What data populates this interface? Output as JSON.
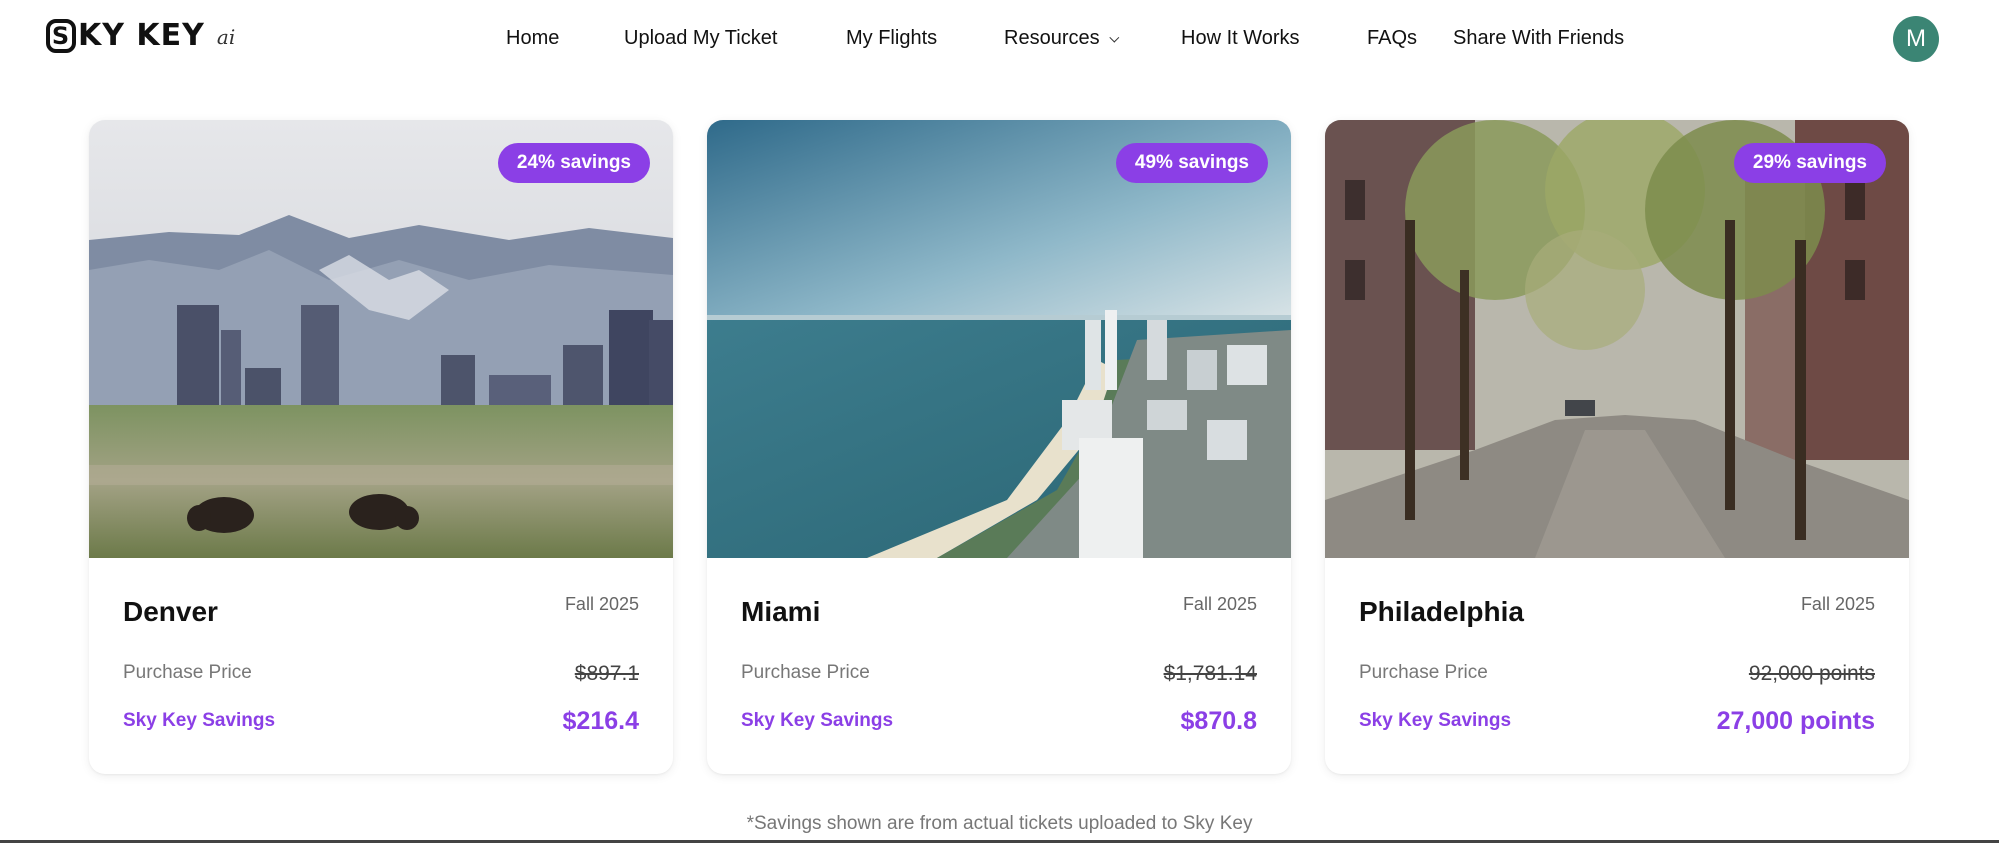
{
  "brand": {
    "logo_text": "KY KEY",
    "logo_s": "S",
    "logo_suffix": "ai"
  },
  "nav": {
    "items": [
      {
        "label": "Home"
      },
      {
        "label": "Upload My Ticket"
      },
      {
        "label": "My Flights"
      },
      {
        "label": "Resources"
      },
      {
        "label": "How It Works"
      },
      {
        "label": "FAQs"
      },
      {
        "label": "Share With Friends"
      }
    ],
    "avatar_initial": "M"
  },
  "cards": [
    {
      "city": "Denver",
      "season": "Fall 2025",
      "badge": "24% savings",
      "purchase_label": "Purchase Price",
      "purchase_price": "$897.1",
      "savings_label": "Sky Key Savings",
      "savings_value": "$216.4"
    },
    {
      "city": "Miami",
      "season": "Fall 2025",
      "badge": "49% savings",
      "purchase_label": "Purchase Price",
      "purchase_price": "$1,781.14",
      "savings_label": "Sky Key Savings",
      "savings_value": "$870.8"
    },
    {
      "city": "Philadelphia",
      "season": "Fall 2025",
      "badge": "29% savings",
      "purchase_label": "Purchase Price",
      "purchase_price": "92,000 points",
      "savings_label": "Sky Key Savings",
      "savings_value": "27,000 points"
    }
  ],
  "footnote": "*Savings shown are from actual tickets uploaded to Sky Key",
  "colors": {
    "accent": "#8b3fe6",
    "avatar": "#3b8574"
  },
  "icons": {
    "resources_dropdown": "chevron-down-icon"
  }
}
